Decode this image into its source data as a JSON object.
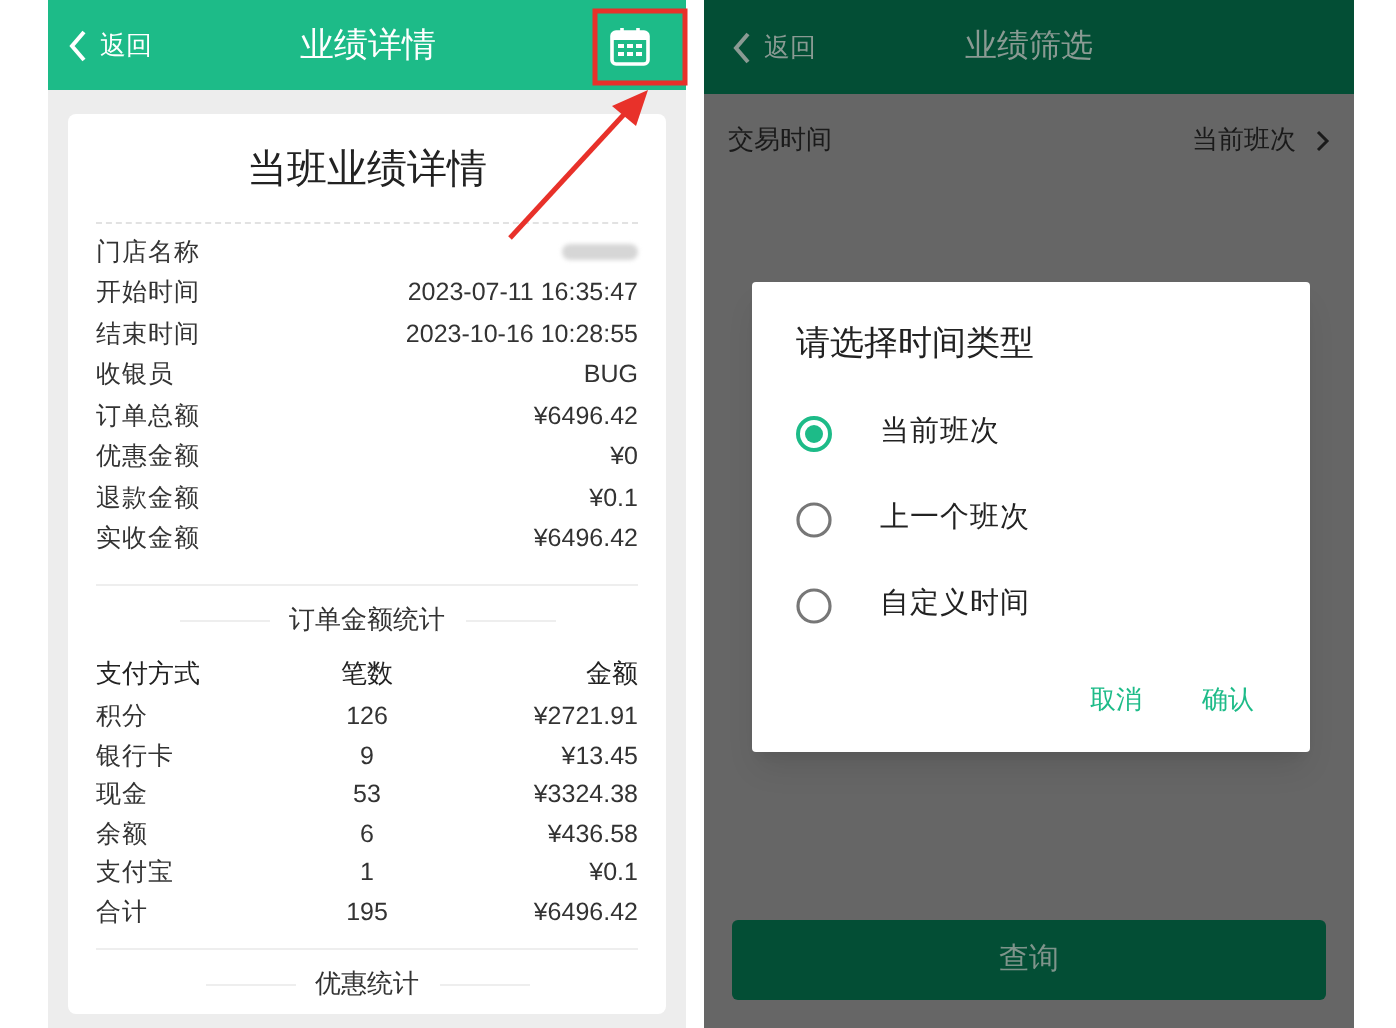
{
  "left_screen": {
    "header": {
      "back": "返回",
      "title": "业绩详情"
    },
    "card": {
      "title": "当班业绩详情",
      "info_rows": [
        {
          "label": "门店名称",
          "kind": "redacted"
        },
        {
          "label": "开始时间",
          "kind": "text",
          "value": "2023-07-11 16:35:47"
        },
        {
          "label": "结束时间",
          "kind": "text",
          "value": "2023-10-16 10:28:55"
        },
        {
          "label": "收银员",
          "kind": "text",
          "value": "BUG"
        },
        {
          "label": "订单总额",
          "kind": "text",
          "value": "¥6496.42"
        },
        {
          "label": "优惠金额",
          "kind": "text",
          "value": "¥0"
        },
        {
          "label": "退款金额",
          "kind": "text",
          "value": "¥0.1"
        },
        {
          "label": "实收金额",
          "kind": "text",
          "value": "¥6496.42"
        }
      ],
      "order_stats": {
        "title": "订单金额统计",
        "columns": [
          "支付方式",
          "笔数",
          "金额"
        ],
        "rows": [
          [
            "积分",
            "126",
            "¥2721.91"
          ],
          [
            "银行卡",
            "9",
            "¥13.45"
          ],
          [
            "现金",
            "53",
            "¥3324.38"
          ],
          [
            "余额",
            "6",
            "¥436.58"
          ],
          [
            "支付宝",
            "1",
            "¥0.1"
          ],
          [
            "合计",
            "195",
            "¥6496.42"
          ]
        ]
      },
      "next_section": "优惠统计"
    }
  },
  "right_screen": {
    "header": {
      "back": "返回",
      "title": "业绩筛选"
    },
    "filter_rows": [
      {
        "label": "交易时间",
        "value": "当前班次"
      }
    ],
    "query_button": "查询",
    "dialog": {
      "title": "请选择时间类型",
      "options": [
        {
          "label": "当前班次",
          "selected": true
        },
        {
          "label": "上一个班次",
          "selected": false
        },
        {
          "label": "自定义时间",
          "selected": false
        }
      ],
      "buttons": [
        "取消",
        "确认"
      ]
    }
  }
}
